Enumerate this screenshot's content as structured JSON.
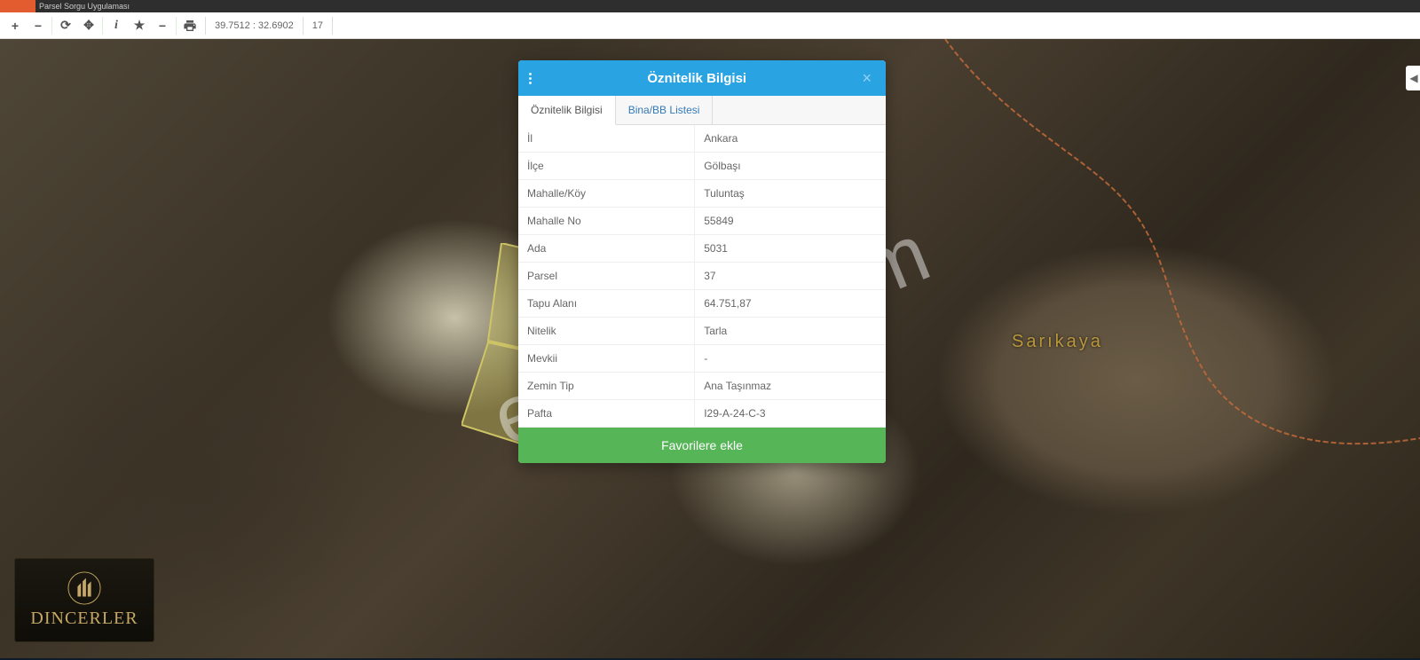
{
  "header": {
    "title": "Parsel Sorgu Uygulaması"
  },
  "toolbar": {
    "coords": "39.7512 : 32.6902",
    "zoom": "17"
  },
  "map": {
    "place_label": "Sarıkaya",
    "watermark": "emlakjet.com"
  },
  "logo": {
    "text": "DINCERLER"
  },
  "modal": {
    "title": "Öznitelik Bilgisi",
    "close": "×",
    "tabs": {
      "attributes": "Öznitelik Bilgisi",
      "bina": "Bina/BB Listesi"
    },
    "rows": [
      {
        "label": "İl",
        "value": "Ankara"
      },
      {
        "label": "İlçe",
        "value": "Gölbaşı"
      },
      {
        "label": "Mahalle/Köy",
        "value": "Tuluntaş"
      },
      {
        "label": "Mahalle No",
        "value": "55849"
      },
      {
        "label": "Ada",
        "value": "5031"
      },
      {
        "label": "Parsel",
        "value": "37"
      },
      {
        "label": "Tapu Alanı",
        "value": "64.751,87"
      },
      {
        "label": "Nitelik",
        "value": "Tarla"
      },
      {
        "label": "Mevkii",
        "value": "-"
      },
      {
        "label": "Zemin Tip",
        "value": "Ana Taşınmaz"
      },
      {
        "label": "Pafta",
        "value": "I29-A-24-C-3"
      }
    ],
    "favorite": "Favorilere ekle"
  }
}
